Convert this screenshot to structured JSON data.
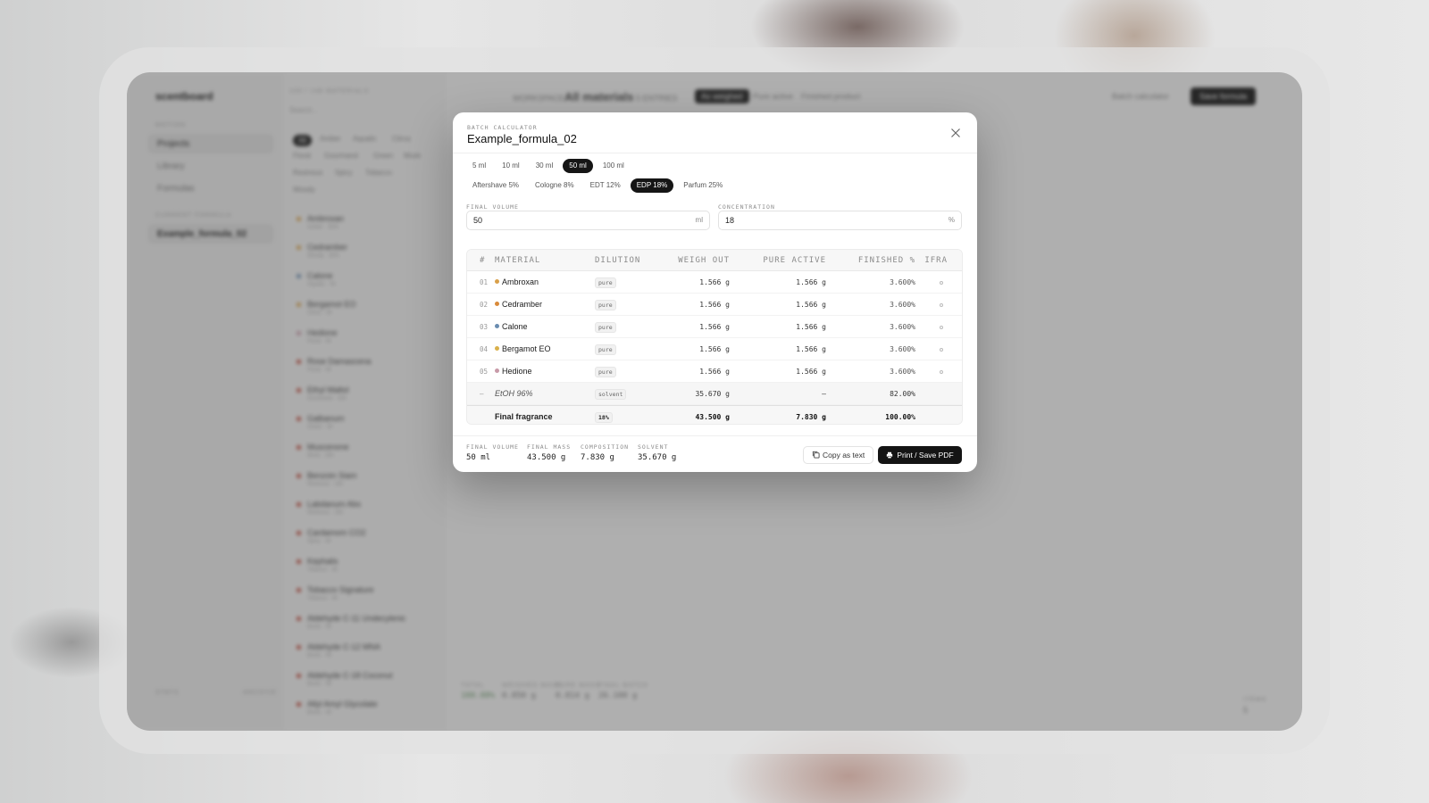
{
  "background_app": {
    "logo": "scentboard",
    "section_label": "MOTION",
    "nav": [
      {
        "label": "Projects"
      },
      {
        "label": "Library"
      },
      {
        "label": "Formulas"
      }
    ],
    "current_formula_label": "CURRENT FORMULA",
    "current_formula": "Example_formula_02",
    "footer_left": "STATS",
    "footer_right": "ARCHIVE",
    "list_header": "100 / 148 MATERIALS",
    "search_placeholder": "Search...",
    "filter_chips": [
      "All",
      "Amber",
      "Aquatic",
      "Citrus",
      "Floral",
      "Gourmand",
      "Green",
      "Musk",
      "Resinous",
      "Spicy",
      "Tobacco",
      "Woody"
    ],
    "materials": [
      {
        "name": "Ambroxan",
        "sub": "Amber · 30%",
        "color": "#d9a04a"
      },
      {
        "name": "Cedramber",
        "sub": "Woody · 30%",
        "color": "#d9a04a"
      },
      {
        "name": "Calone",
        "sub": "Aquatic · 4h",
        "color": "#6a8cb0"
      },
      {
        "name": "Bergamot EO",
        "sub": "Citrus · 4h",
        "color": "#d9a04a"
      },
      {
        "name": "Hedione",
        "sub": "Floral · 4h",
        "color": "#c89aa8"
      },
      {
        "name": "Rose Damascena",
        "sub": "Floral · 4h",
        "color": "#c0483a"
      },
      {
        "name": "Ethyl Maltol",
        "sub": "Gourmand · 10h",
        "color": "#c0483a"
      },
      {
        "name": "Galbanum",
        "sub": "Green · 4h",
        "color": "#c0483a"
      },
      {
        "name": "Muscenone",
        "sub": "Musk · 24h",
        "color": "#c0483a"
      },
      {
        "name": "Benzoin Siam",
        "sub": "Resinous · 24h",
        "color": "#c0483a"
      },
      {
        "name": "Labdanum Abs",
        "sub": "Resinous · 24h",
        "color": "#c0483a"
      },
      {
        "name": "Cardamom CO2",
        "sub": "Spicy · 4h",
        "color": "#c0483a"
      },
      {
        "name": "Kephalis",
        "sub": "Tobacco · 4h",
        "color": "#c0483a"
      },
      {
        "name": "Tobacco Signature",
        "sub": "Tobacco · 4h",
        "color": "#c0483a"
      },
      {
        "name": "Aldehyde C-11 Undecylenic",
        "sub": "Bouts · 4h",
        "color": "#c0483a"
      },
      {
        "name": "Aldehyde C-12 MNA",
        "sub": "Bouts · 4h",
        "color": "#c0483a"
      },
      {
        "name": "Aldehyde C-18 Coconut",
        "sub": "Bouts · 4h",
        "color": "#c0483a"
      },
      {
        "name": "Allyl Amyl Glycolate",
        "sub": "Bouts · 4h",
        "color": "#c0483a"
      }
    ],
    "breadcrumb": "WORKSPACE",
    "main_title": "All materials",
    "entries": "5 ENTRIES",
    "view_tabs": [
      "As weighed",
      "Pure active",
      "Finished product"
    ],
    "batch_calculator_label": "Batch calculator",
    "save_formula_label": "Save formula",
    "bottom_stats": [
      {
        "label": "TOTAL",
        "value": "100.00%"
      },
      {
        "label": "WEIGHED MASS",
        "value": "0.850 g"
      },
      {
        "label": "PURE MASS",
        "value": "0.814 g"
      },
      {
        "label": "FINAL BATCH",
        "value": "26.100 g"
      }
    ],
    "items_label": "ITEMS",
    "items_value": "5"
  },
  "dialog": {
    "eyebrow": "BATCH CALCULATOR",
    "title": "Example_formula_02",
    "volume_pills": [
      {
        "label": "5 ml",
        "active": false
      },
      {
        "label": "10 ml",
        "active": false
      },
      {
        "label": "30 ml",
        "active": false
      },
      {
        "label": "50 ml",
        "active": true
      },
      {
        "label": "100 ml",
        "active": false
      }
    ],
    "concentration_pills": [
      {
        "label": "Aftershave 5%",
        "active": false
      },
      {
        "label": "Cologne 8%",
        "active": false
      },
      {
        "label": "EDT 12%",
        "active": false
      },
      {
        "label": "EDP 18%",
        "active": true
      },
      {
        "label": "Parfum 25%",
        "active": false
      }
    ],
    "final_volume": {
      "label": "FINAL VOLUME",
      "value": "50",
      "unit": "ml"
    },
    "concentration": {
      "label": "CONCENTRATION",
      "value": "18",
      "unit": "%"
    },
    "table": {
      "headers": {
        "idx": "#",
        "material": "MATERIAL",
        "dilution": "DILUTION",
        "weigh_out": "WEIGH OUT",
        "pure_active": "PURE ACTIVE",
        "finished": "FINISHED %",
        "ifra": "IFRA"
      },
      "rows": [
        {
          "idx": "01",
          "name": "Ambroxan",
          "color": "#d9a04a",
          "dilution": "pure",
          "weigh_out": "1.566 g",
          "pure_active": "1.566 g",
          "finished": "3.600%"
        },
        {
          "idx": "02",
          "name": "Cedramber",
          "color": "#d98a3a",
          "dilution": "pure",
          "weigh_out": "1.566 g",
          "pure_active": "1.566 g",
          "finished": "3.600%"
        },
        {
          "idx": "03",
          "name": "Calone",
          "color": "#6a8cb0",
          "dilution": "pure",
          "weigh_out": "1.566 g",
          "pure_active": "1.566 g",
          "finished": "3.600%"
        },
        {
          "idx": "04",
          "name": "Bergamot EO",
          "color": "#d9b04a",
          "dilution": "pure",
          "weigh_out": "1.566 g",
          "pure_active": "1.566 g",
          "finished": "3.600%"
        },
        {
          "idx": "05",
          "name": "Hedione",
          "color": "#c89aa8",
          "dilution": "pure",
          "weigh_out": "1.566 g",
          "pure_active": "1.566 g",
          "finished": "3.600%"
        }
      ],
      "solvent": {
        "idx": "—",
        "name": "EtOH 96%",
        "dilution": "solvent",
        "weigh_out": "35.670 g",
        "pure_active": "—",
        "finished": "82.00%"
      },
      "total": {
        "name": "Final fragrance",
        "badge": "18%",
        "weigh_out": "43.500 g",
        "pure_active": "7.830 g",
        "finished": "100.00%"
      }
    },
    "footer_stats": [
      {
        "label": "FINAL VOLUME",
        "value": "50 ml"
      },
      {
        "label": "FINAL MASS",
        "value": "43.500 g"
      },
      {
        "label": "COMPOSITION",
        "value": "7.830 g"
      },
      {
        "label": "SOLVENT",
        "value": "35.670 g"
      }
    ],
    "copy_label": "Copy as text",
    "print_label": "Print / Save PDF"
  }
}
